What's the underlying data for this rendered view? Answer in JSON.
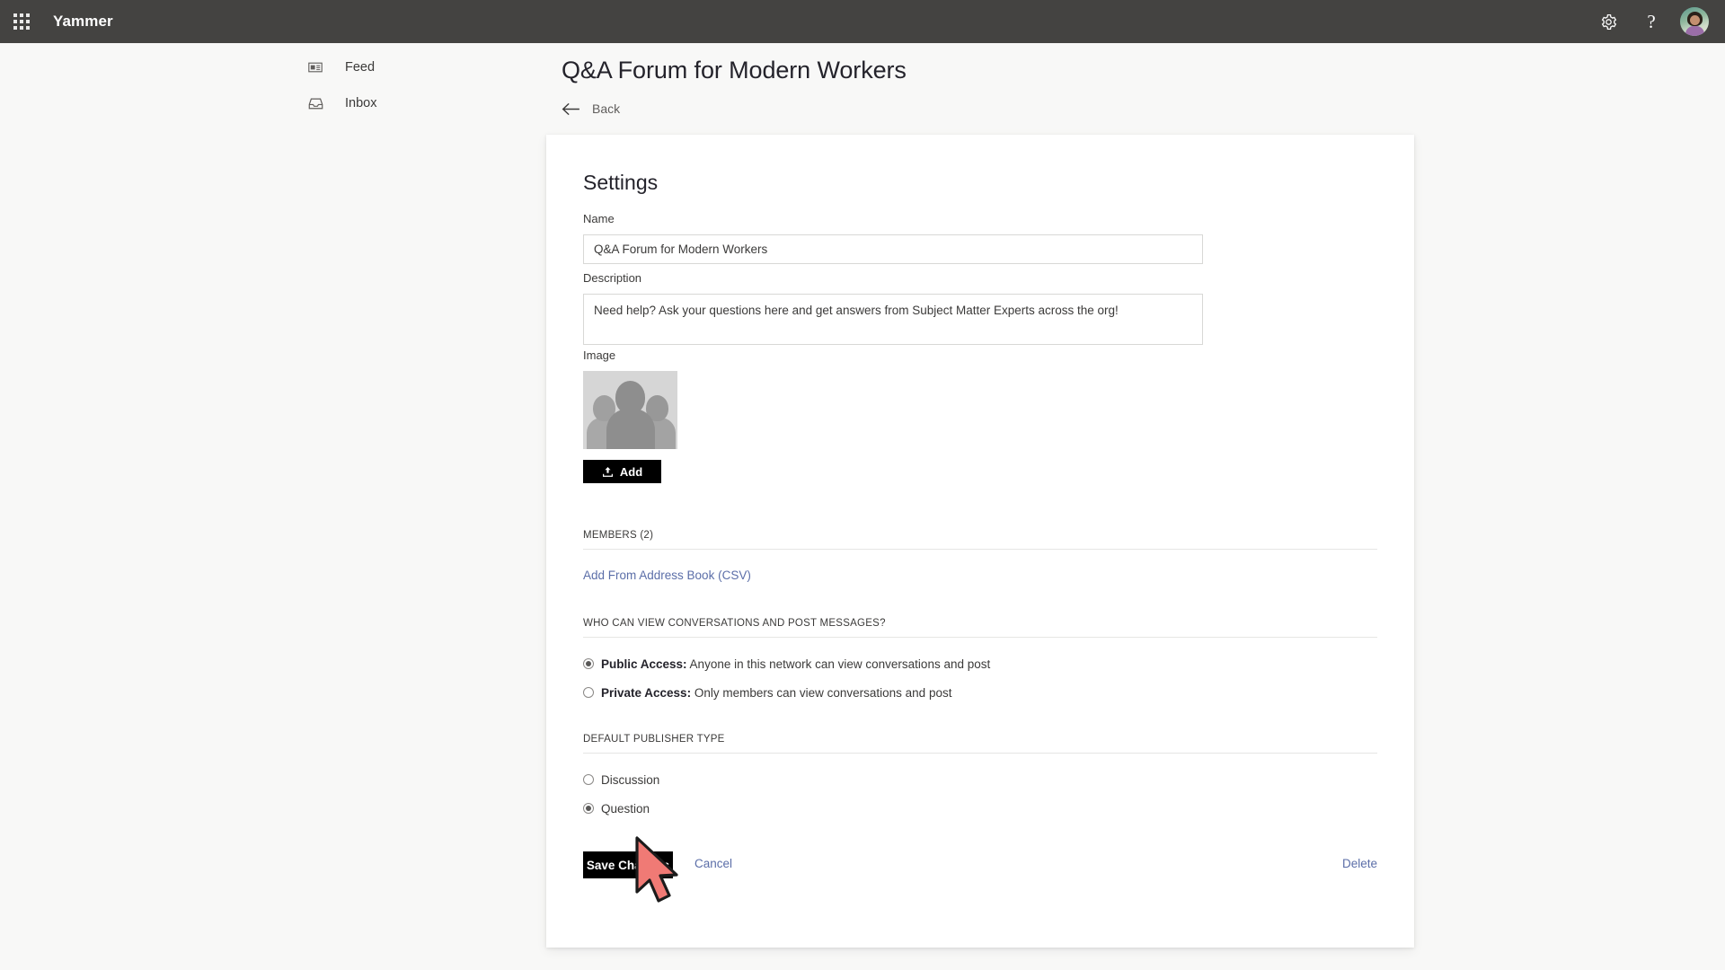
{
  "topbar": {
    "app_launcher_icon": "waffle-grid-icon",
    "brand": "Yammer",
    "settings_icon": "gear-icon",
    "help_icon": "question-mark-icon",
    "avatar_icon": "user-avatar",
    "background_color": "#444341"
  },
  "sidebar": {
    "items": [
      {
        "label": "Feed",
        "icon": "feed-icon"
      },
      {
        "label": "Inbox",
        "icon": "inbox-tray-icon"
      }
    ]
  },
  "header": {
    "title": "Q&A Forum for Modern Workers",
    "back_label": "Back",
    "back_icon": "arrow-left-icon"
  },
  "settings": {
    "heading": "Settings",
    "name": {
      "label": "Name",
      "value": "Q&A Forum for Modern Workers",
      "placeholder": "Group name"
    },
    "description": {
      "label": "Description",
      "value": "Need help? Ask your questions here and get answers from Subject Matter Experts across the org!",
      "placeholder": "Group description"
    },
    "image": {
      "label": "Image",
      "thumbnail_alt": "group-placeholder-photo",
      "add_button": "Add",
      "add_icon": "upload-icon"
    },
    "members": {
      "heading": "MEMBERS (2)",
      "count": 2,
      "add_link": "Add From Address Book (CSV)"
    },
    "access": {
      "heading": "WHO CAN VIEW CONVERSATIONS AND POST MESSAGES?",
      "options": [
        {
          "strong": "Public Access:",
          "text": " Anyone in this network can view conversations and post",
          "selected": true
        },
        {
          "strong": "Private Access:",
          "text": " Only members can view conversations and post",
          "selected": false
        }
      ]
    },
    "publisher": {
      "heading": "DEFAULT PUBLISHER TYPE",
      "options": [
        {
          "label": "Discussion",
          "selected": false
        },
        {
          "label": "Question",
          "selected": true
        }
      ]
    },
    "footer": {
      "save_label": "Save Changes",
      "cancel_label": "Cancel",
      "delete_label": "Delete"
    }
  },
  "colors": {
    "topbar": "#444341",
    "page_bg": "#f8f8f7",
    "card_bg": "#ffffff",
    "link": "#5b6ea8",
    "button_dark": "#000000",
    "cursor": "#f07a75"
  }
}
